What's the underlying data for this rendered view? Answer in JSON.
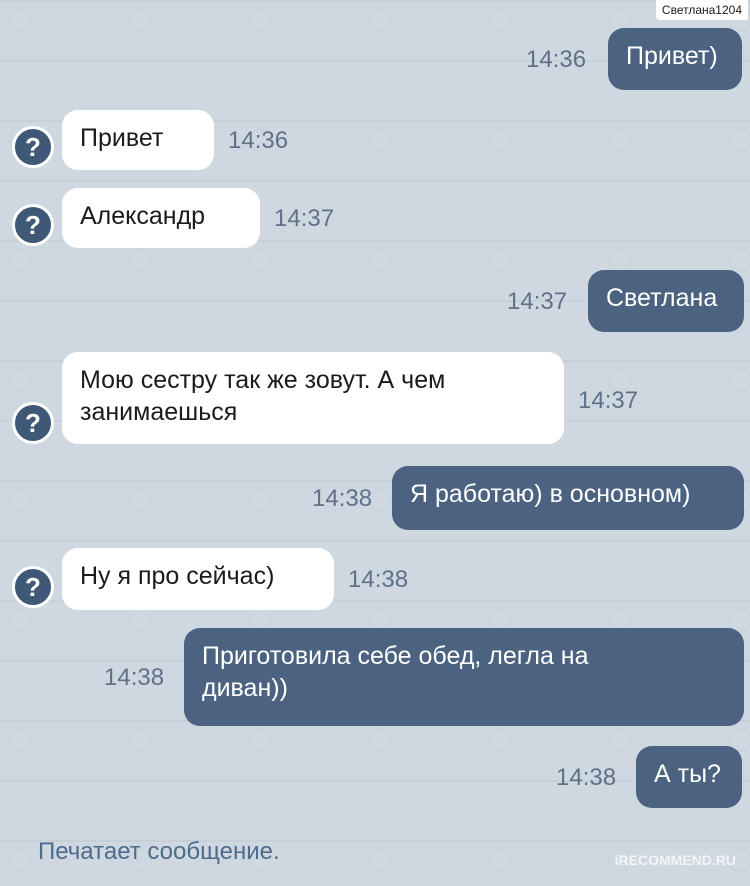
{
  "header": {
    "username": "Светлана1204"
  },
  "messages": [
    {
      "dir": "out",
      "text": "Привет)",
      "time": "14:36"
    },
    {
      "dir": "in",
      "text": "Привет",
      "time": "14:36"
    },
    {
      "dir": "in",
      "text": "Александр",
      "time": "14:37"
    },
    {
      "dir": "out",
      "text": "Светлана",
      "time": "14:37"
    },
    {
      "dir": "in",
      "text": "Мою сестру так же зовут. А чем\nзанимаешься",
      "time": "14:37"
    },
    {
      "dir": "out",
      "text": "Я работаю) в основном)",
      "time": "14:38"
    },
    {
      "dir": "in",
      "text": "Ну я про сейчас)",
      "time": "14:38"
    },
    {
      "dir": "out",
      "text": "Приготовила себе обед, легла на\nдиван))",
      "time": "14:38"
    },
    {
      "dir": "out",
      "text": "А ты?",
      "time": "14:38"
    }
  ],
  "avatar_icon": "question-mark-icon",
  "avatar_glyph": "?",
  "typing_status": "Печатает сообщение.",
  "watermark": "iRECOMMEND.RU",
  "colors": {
    "incoming_bubble": "#ffffff",
    "outgoing_bubble": "#4b6380",
    "background": "#cfd8e0",
    "timestamp": "#5e7189"
  }
}
